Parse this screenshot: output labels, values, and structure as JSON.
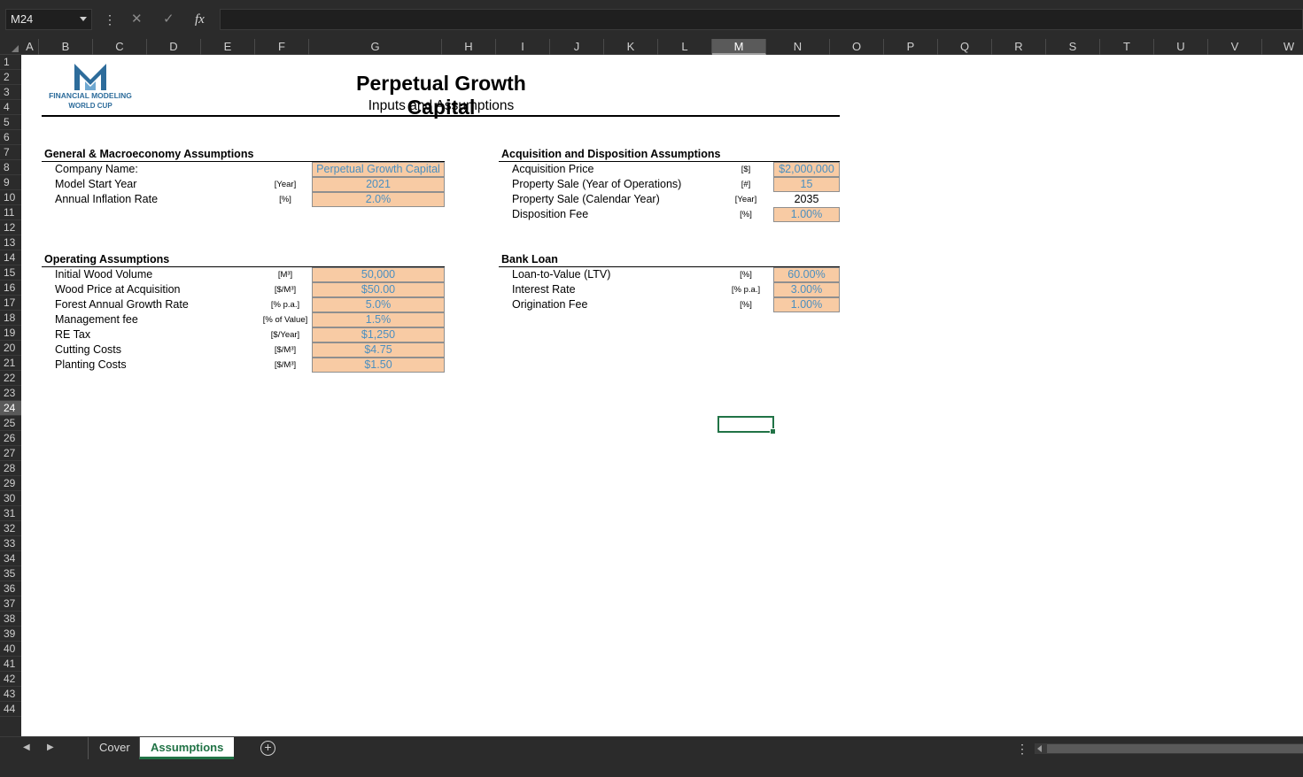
{
  "formula_bar": {
    "name_box": "M24",
    "cancel_icon": "✕",
    "enter_icon": "✓",
    "fx_label": "fx",
    "formula": ""
  },
  "columns": [
    "A",
    "B",
    "C",
    "D",
    "E",
    "F",
    "G",
    "H",
    "I",
    "J",
    "K",
    "L",
    "M",
    "N",
    "O",
    "P",
    "Q",
    "R",
    "S",
    "T",
    "U",
    "V",
    "W"
  ],
  "selected_column": "M",
  "rows": [
    "1",
    "2",
    "3",
    "4",
    "5",
    "6",
    "7",
    "8",
    "9",
    "10",
    "11",
    "12",
    "13",
    "14",
    "15",
    "16",
    "17",
    "18",
    "19",
    "20",
    "21",
    "22",
    "23",
    "24",
    "25",
    "26",
    "27",
    "28",
    "29",
    "30",
    "31",
    "32",
    "33",
    "34",
    "35",
    "36",
    "37",
    "38",
    "39",
    "40",
    "41",
    "42",
    "43",
    "44"
  ],
  "selected_row": "24",
  "logo": {
    "line1": "FINANCIAL MODELING",
    "line2": "WORLD CUP",
    "color": "#2d6c9b"
  },
  "title": "Perpetual Growth Capital",
  "subtitle": "Inputs and Assumptions",
  "general": {
    "header": "General & Macroeconomy Assumptions",
    "items": [
      {
        "label": "Company Name:",
        "unit": "",
        "value": "Perpetual Growth Capital"
      },
      {
        "label": "Model Start Year",
        "unit": "[Year]",
        "value": "2021"
      },
      {
        "label": "Annual Inflation Rate",
        "unit": "[%]",
        "value": "2.0%"
      }
    ]
  },
  "acquisition": {
    "header": "Acquisition and Disposition Assumptions",
    "items": [
      {
        "label": "Acquisition Price",
        "unit": "[$]",
        "value": "$2,000,000",
        "input": true
      },
      {
        "label": "Property Sale (Year of Operations)",
        "unit": "[#]",
        "value": "15",
        "input": true
      },
      {
        "label": "Property Sale (Calendar Year)",
        "unit": "[Year]",
        "value": "2035",
        "input": false
      },
      {
        "label": "Disposition Fee",
        "unit": "[%]",
        "value": "1.00%",
        "input": true
      }
    ]
  },
  "operating": {
    "header": "Operating Assumptions",
    "items": [
      {
        "label": "Initial Wood Volume",
        "unit": "[M³]",
        "value": "50,000"
      },
      {
        "label": "Wood Price at Acquisition",
        "unit": "[$/M³]",
        "value": "$50.00"
      },
      {
        "label": "Forest Annual Growth Rate",
        "unit": "[% p.a.]",
        "value": "5.0%"
      },
      {
        "label": "Management fee",
        "unit": "[% of Value]",
        "value": "1.5%"
      },
      {
        "label": "RE Tax",
        "unit": "[$/Year]",
        "value": "$1,250"
      },
      {
        "label": "Cutting Costs",
        "unit": "[$/M³]",
        "value": "$4.75"
      },
      {
        "label": "Planting Costs",
        "unit": "[$/M³]",
        "value": "$1.50"
      }
    ]
  },
  "bank_loan": {
    "header": "Bank Loan",
    "items": [
      {
        "label": "Loan-to-Value (LTV)",
        "unit": "[%]",
        "value": "60.00%"
      },
      {
        "label": "Interest Rate",
        "unit": "[% p.a.]",
        "value": "3.00%"
      },
      {
        "label": "Origination Fee",
        "unit": "[%]",
        "value": "1.00%"
      }
    ]
  },
  "sheet_tabs": [
    {
      "label": "Cover",
      "active": false
    },
    {
      "label": "Assumptions",
      "active": true
    }
  ],
  "colors": {
    "input_fill": "#f8cba4",
    "input_text": "#4b8fc0",
    "accent": "#217346"
  }
}
